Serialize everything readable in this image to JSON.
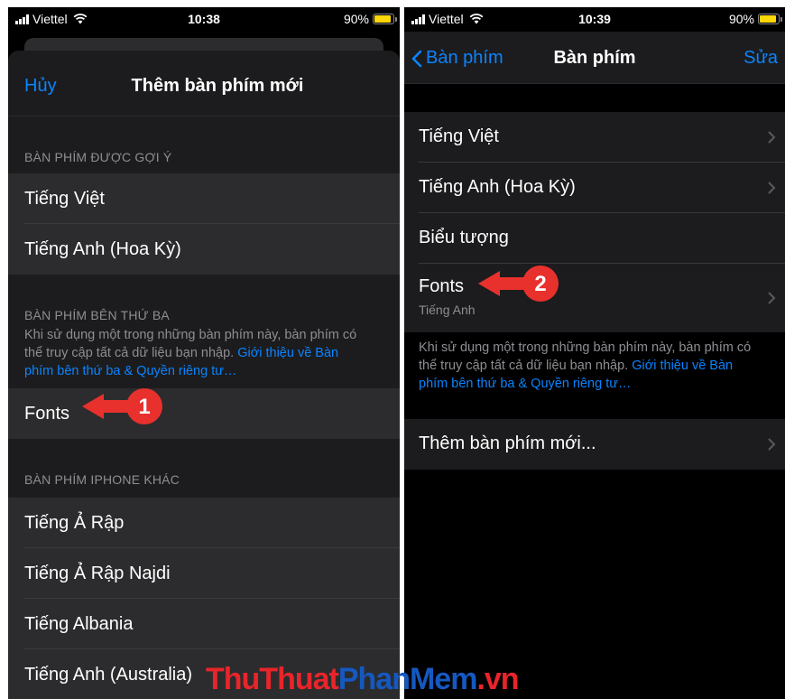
{
  "left": {
    "status": {
      "carrier": "Viettel",
      "time": "10:38",
      "battery": "90%",
      "battery_level": 0.9
    },
    "header": {
      "cancel": "Hủy",
      "title": "Thêm bàn phím mới"
    },
    "suggested": {
      "heading": "BÀN PHÍM ĐƯỢC GỢI Ý",
      "items": [
        {
          "label": "Tiếng Việt"
        },
        {
          "label": "Tiếng Anh (Hoa Kỳ)"
        }
      ]
    },
    "third_party": {
      "heading": "BÀN PHÍM BÊN THỨ BA",
      "note_line1": "Khi sử dụng một trong những bàn phím này, bàn phím có",
      "note_line2": "thể truy cập tất cả dữ liệu bạn nhập. ",
      "note_link_line1": "Giới thiệu về Bàn",
      "note_link_line2": "phím bên thứ ba & Quyền riêng tư…",
      "items": [
        {
          "label": "Fonts"
        }
      ]
    },
    "other": {
      "heading": "BÀN PHÍM IPHONE KHÁC",
      "items": [
        {
          "label": "Tiếng Ả Rập"
        },
        {
          "label": "Tiếng Ả Rập Najdi"
        },
        {
          "label": "Tiếng Albania"
        },
        {
          "label": "Tiếng Anh (Australia)"
        }
      ]
    }
  },
  "right": {
    "status": {
      "carrier": "Viettel",
      "time": "10:39",
      "battery": "90%",
      "battery_level": 0.9
    },
    "nav": {
      "back": "Bàn phím",
      "title": "Bàn phím",
      "edit": "Sửa"
    },
    "keyboards": [
      {
        "label": "Tiếng Việt"
      },
      {
        "label": "Tiếng Anh (Hoa Kỳ)"
      },
      {
        "label": "Biểu tượng"
      },
      {
        "label": "Fonts",
        "sub": "Tiếng Anh"
      }
    ],
    "note_line1": "Khi sử dụng một trong những bàn phím này, bàn phím có",
    "note_line2": "thể truy cập tất cả dữ liệu bạn nhập. ",
    "note_link_line1": "Giới thiệu về Bàn",
    "note_link_line2": "phím bên thứ ba & Quyền riêng tư…",
    "add_keyboard": "Thêm bàn phím mới..."
  },
  "callouts": {
    "one": "1",
    "two": "2",
    "color": "#e8312d"
  },
  "watermark": {
    "part1": "ThuThuat",
    "part2": "PhanMem",
    "part3": ".vn"
  },
  "colors": {
    "accent": "#0a84ff",
    "background": "#000000",
    "cell": "#2c2c2e",
    "secondary_text": "#8e8e93"
  }
}
